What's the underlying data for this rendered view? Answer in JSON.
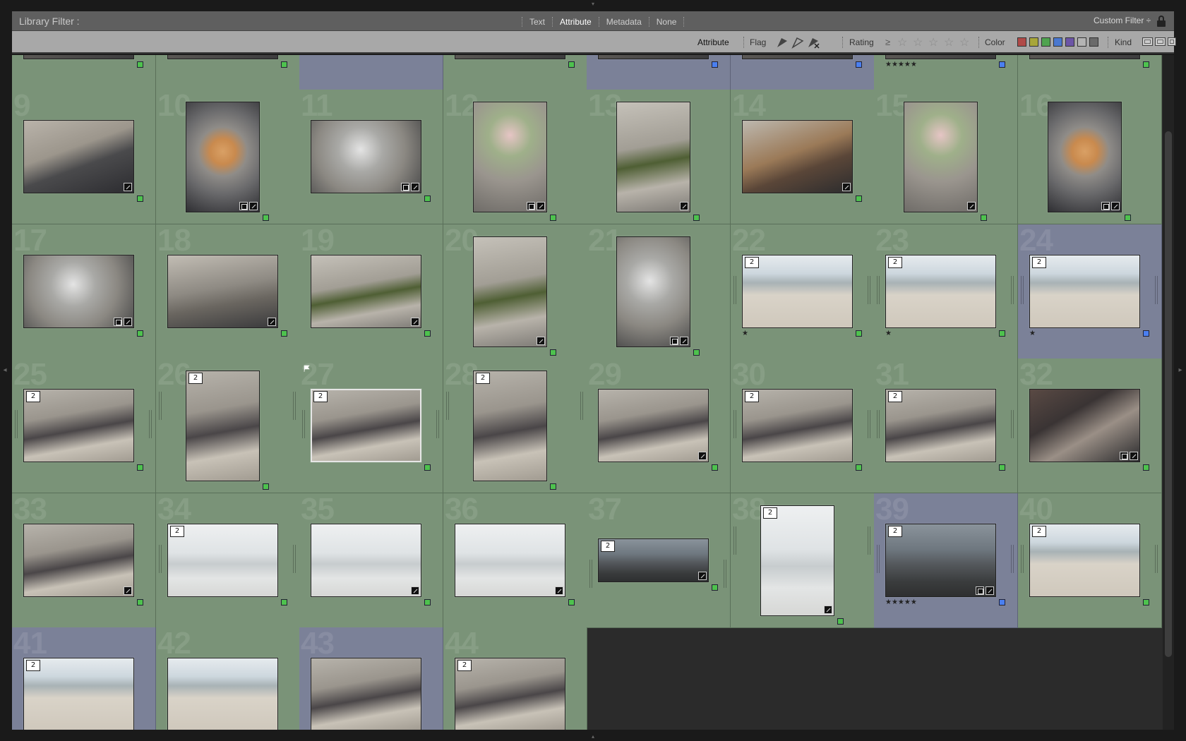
{
  "filter_bar": {
    "title": "Library Filter :",
    "tabs": [
      "Text",
      "Attribute",
      "Metadata",
      "None"
    ],
    "active_tab": "Attribute",
    "preset": "Custom Filter ÷"
  },
  "attribute_bar": {
    "heading": "Attribute",
    "flag_label": "Flag",
    "rating_label": "Rating",
    "rating_op": "≥",
    "color_label": "Color",
    "kind_label": "Kind",
    "color_swatches": [
      "#b04a48",
      "#a8a63a",
      "#4fa34f",
      "#4a78d0",
      "#6c55a6",
      "#b4b4b4",
      "#6a6a6a"
    ]
  },
  "colors": {
    "cell_green": "#7a9378",
    "cell_blue": "#7b8198",
    "label_green": "#4ec24e",
    "label_blue": "#4a7ff0"
  },
  "grid": {
    "cells": [
      {
        "n": "",
        "bg": "green",
        "orient": "land",
        "label": "green",
        "partial": true
      },
      {
        "n": "",
        "bg": "green",
        "orient": "land",
        "label": "green",
        "partial": true
      },
      {
        "n": "",
        "bg": "blue",
        "orient": "small",
        "label": "blue",
        "partial": true
      },
      {
        "n": "",
        "bg": "green",
        "orient": "land",
        "label": "green",
        "partial": true
      },
      {
        "n": "",
        "bg": "blue",
        "orient": "land",
        "label": "blue",
        "partial": true
      },
      {
        "n": "",
        "bg": "blue",
        "orient": "land",
        "label": "blue",
        "partial": true
      },
      {
        "n": "",
        "bg": "green",
        "orient": "land",
        "label": "blue",
        "partial": true,
        "rating": "★★★★★"
      },
      {
        "n": "",
        "bg": "green",
        "orient": "land",
        "label": "green",
        "partial": true
      },
      {
        "n": "9",
        "bg": "green",
        "orient": "land",
        "label": "green",
        "badges": "e",
        "scene": "pastry"
      },
      {
        "n": "10",
        "bg": "green",
        "orient": "port",
        "label": "green",
        "badges": "ce",
        "scene": "donuts"
      },
      {
        "n": "11",
        "bg": "green",
        "orient": "land",
        "label": "green",
        "badges": "ce",
        "scene": "lantern"
      },
      {
        "n": "12",
        "bg": "green",
        "orient": "port",
        "label": "green",
        "badges": "ce",
        "scene": "flowers"
      },
      {
        "n": "13",
        "bg": "green",
        "orient": "port",
        "label": "green",
        "badges": "e",
        "scene": "bottle"
      },
      {
        "n": "14",
        "bg": "green",
        "orient": "land",
        "label": "green",
        "badges": "e",
        "scene": "basket"
      },
      {
        "n": "15",
        "bg": "green",
        "orient": "port",
        "label": "green",
        "badges": "e",
        "scene": "flowers"
      },
      {
        "n": "16",
        "bg": "green",
        "orient": "port",
        "label": "green",
        "badges": "ce",
        "scene": "donuts"
      },
      {
        "n": "17",
        "bg": "green",
        "orient": "land",
        "label": "green",
        "badges": "ce",
        "scene": "lantern"
      },
      {
        "n": "18",
        "bg": "green",
        "orient": "land",
        "label": "green",
        "badges": "e",
        "scene": "rocks"
      },
      {
        "n": "19",
        "bg": "green",
        "orient": "land",
        "label": "green",
        "badges": "e",
        "scene": "bottle"
      },
      {
        "n": "20",
        "bg": "green",
        "orient": "port",
        "label": "green",
        "badges": "e",
        "scene": "bottle"
      },
      {
        "n": "21",
        "bg": "green",
        "orient": "port",
        "label": "green",
        "badges": "ce",
        "scene": "lantern"
      },
      {
        "n": "22",
        "bg": "green",
        "orient": "land",
        "label": "green",
        "stack": "2",
        "rating": "★",
        "scene": "beach",
        "stackbar": true
      },
      {
        "n": "23",
        "bg": "green",
        "orient": "land",
        "label": "green",
        "stack": "2",
        "rating": "★",
        "scene": "beach",
        "stackbar": true
      },
      {
        "n": "24",
        "bg": "blue",
        "orient": "land",
        "label": "blue",
        "stack": "2",
        "rating": "★",
        "scene": "beach",
        "stackbar": true
      },
      {
        "n": "25",
        "bg": "green",
        "orient": "land",
        "label": "green",
        "stack": "2",
        "scene": "couple",
        "stackbar": true
      },
      {
        "n": "26",
        "bg": "green",
        "orient": "port",
        "label": "green",
        "stack": "2",
        "scene": "couple",
        "stackbar": true
      },
      {
        "n": "27",
        "bg": "green",
        "orient": "land",
        "label": "green",
        "stack": "2",
        "scene": "couple",
        "selected": true,
        "flag": true,
        "stackbar": true
      },
      {
        "n": "28",
        "bg": "green",
        "orient": "port",
        "label": "green",
        "stack": "2",
        "scene": "couple",
        "stackbar": true
      },
      {
        "n": "29",
        "bg": "green",
        "orient": "land",
        "label": "green",
        "badges": "e",
        "scene": "couple"
      },
      {
        "n": "30",
        "bg": "green",
        "orient": "land",
        "label": "green",
        "stack": "2",
        "scene": "couple",
        "stackbar": true
      },
      {
        "n": "31",
        "bg": "green",
        "orient": "land",
        "label": "green",
        "stack": "2",
        "scene": "couple",
        "stackbar": true
      },
      {
        "n": "32",
        "bg": "green",
        "orient": "land",
        "label": "green",
        "badges": "ce",
        "scene": "toast"
      },
      {
        "n": "33",
        "bg": "green",
        "orient": "land",
        "label": "green",
        "badges": "e",
        "scene": "couple"
      },
      {
        "n": "34",
        "bg": "green",
        "orient": "land",
        "label": "green",
        "stack": "2",
        "scene": "shore",
        "stackbar": true
      },
      {
        "n": "35",
        "bg": "green",
        "orient": "land",
        "label": "green",
        "badges": "e",
        "scene": "shore"
      },
      {
        "n": "36",
        "bg": "green",
        "orient": "land",
        "label": "green",
        "badges": "e",
        "scene": "shore"
      },
      {
        "n": "37",
        "bg": "green",
        "orient": "pano",
        "label": "green",
        "stack": "2",
        "badges": "e",
        "scene": "dusk",
        "stackbar": true
      },
      {
        "n": "38",
        "bg": "green",
        "orient": "port",
        "label": "green",
        "stack": "2",
        "badges": "e",
        "scene": "shore",
        "stackbar": true
      },
      {
        "n": "39",
        "bg": "blue",
        "orient": "land",
        "label": "blue",
        "stack": "2",
        "badges": "ce",
        "rating": "★★★★★",
        "scene": "dusk",
        "stackbar": true
      },
      {
        "n": "40",
        "bg": "green",
        "orient": "land",
        "label": "green",
        "stack": "2",
        "scene": "beach",
        "stackbar": true
      },
      {
        "n": "41",
        "bg": "blue",
        "orient": "land",
        "label": "",
        "stack": "2",
        "scene": "beach",
        "partialbottom": true
      },
      {
        "n": "42",
        "bg": "green",
        "orient": "land",
        "label": "",
        "scene": "beach",
        "partialbottom": true
      },
      {
        "n": "43",
        "bg": "blue",
        "orient": "land",
        "label": "",
        "scene": "couple",
        "partialbottom": true
      },
      {
        "n": "44",
        "bg": "green",
        "orient": "land",
        "label": "",
        "stack": "2",
        "scene": "couple",
        "partialbottom": true
      }
    ]
  }
}
